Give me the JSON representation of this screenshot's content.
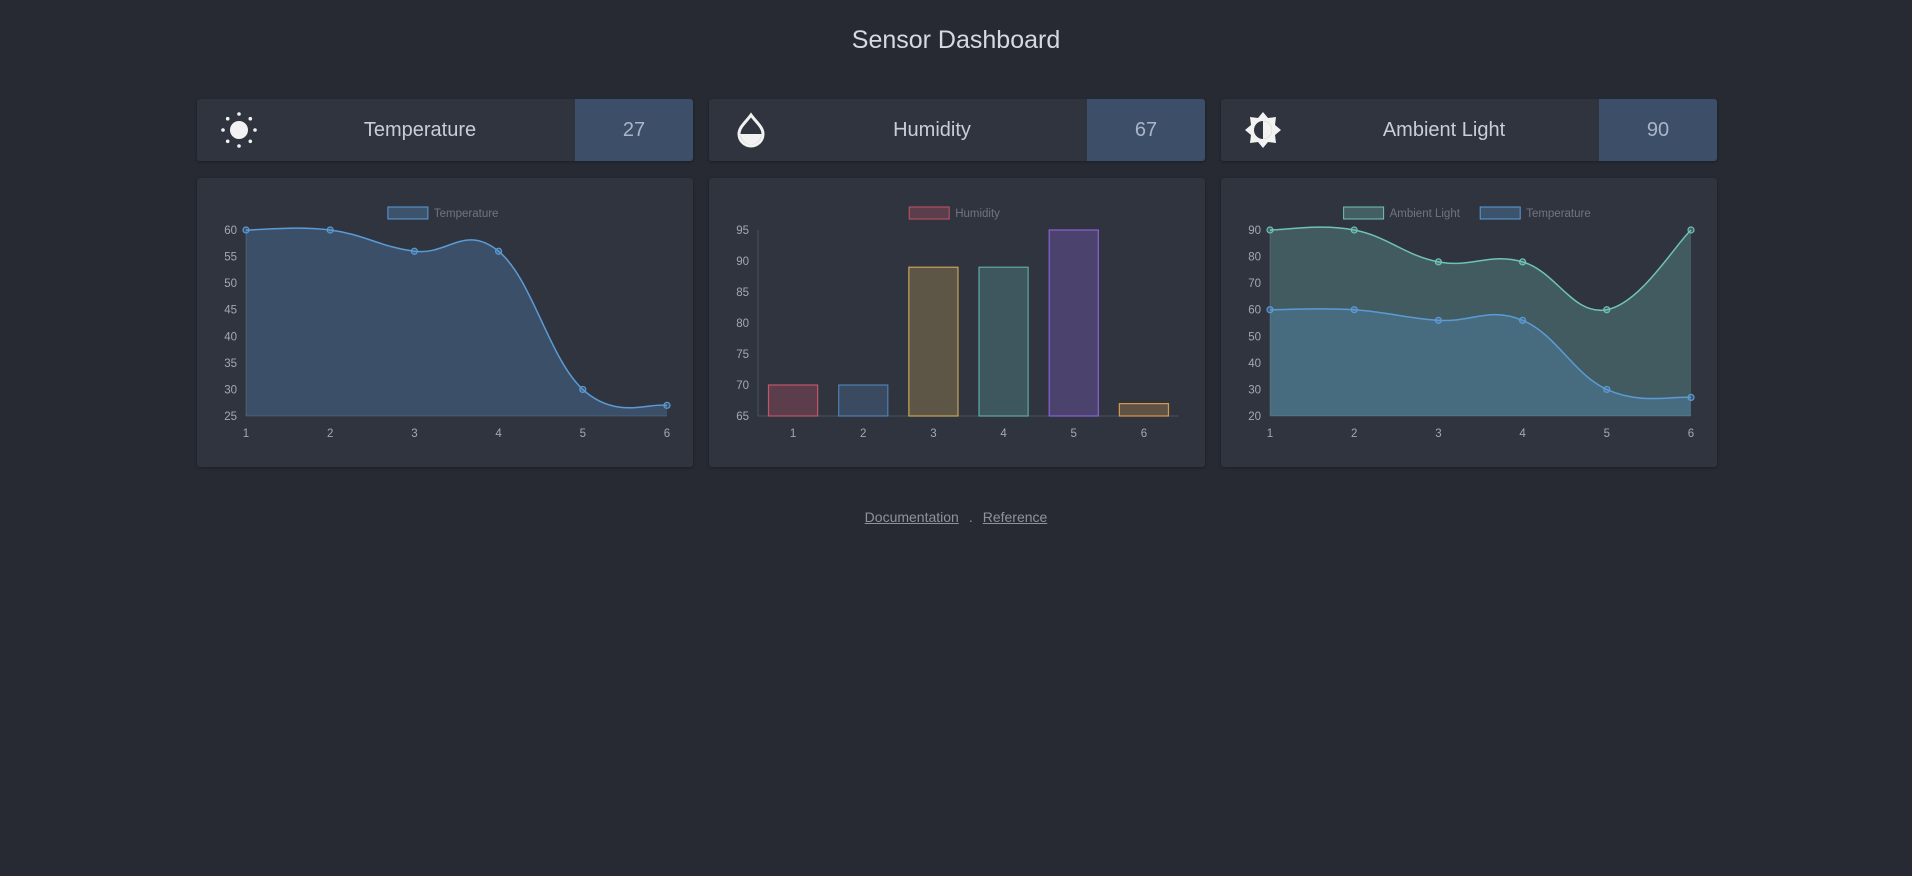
{
  "page": {
    "title": "Sensor Dashboard"
  },
  "cards": [
    {
      "label": "Temperature",
      "value": "27",
      "icon": "sun-icon"
    },
    {
      "label": "Humidity",
      "value": "67",
      "icon": "droplet-icon"
    },
    {
      "label": "Ambient Light",
      "value": "90",
      "icon": "brightness-icon"
    }
  ],
  "footer": {
    "links": [
      "Documentation",
      "Reference"
    ],
    "separator": "."
  },
  "colors": {
    "background": "#272a33",
    "panel": "#30343f",
    "value_box": "#3d4e68",
    "temperature": "#5b9bd5",
    "ambient_light": "#6fc3b6"
  },
  "chart_data": [
    {
      "type": "area",
      "x": [
        "1",
        "2",
        "3",
        "4",
        "5",
        "6"
      ],
      "ylim": [
        25,
        60
      ],
      "yticks": [
        25,
        30,
        35,
        40,
        45,
        50,
        55,
        60
      ],
      "series": [
        {
          "name": "Temperature",
          "values": [
            60,
            60,
            56,
            56,
            30,
            27
          ],
          "color": "#5b9bd5"
        }
      ],
      "legend": "top-center",
      "grid": false
    },
    {
      "type": "bar",
      "categories": [
        "1",
        "2",
        "3",
        "4",
        "5",
        "6"
      ],
      "ylim": [
        65,
        95
      ],
      "yticks": [
        65,
        70,
        75,
        80,
        85,
        90,
        95
      ],
      "series": [
        {
          "name": "Humidity",
          "values": [
            70,
            70,
            89,
            89,
            95,
            67
          ]
        }
      ],
      "bar_colors": [
        "#c4546a",
        "#4f7fb0",
        "#c8a558",
        "#5fa8a6",
        "#8a62d6",
        "#d39a4f"
      ],
      "legend": "top-center",
      "grid": false
    },
    {
      "type": "area",
      "x": [
        "1",
        "2",
        "3",
        "4",
        "5",
        "6"
      ],
      "ylim": [
        20,
        90
      ],
      "yticks": [
        20,
        30,
        40,
        50,
        60,
        70,
        80,
        90
      ],
      "series": [
        {
          "name": "Ambient Light",
          "values": [
            90,
            90,
            78,
            78,
            60,
            90
          ],
          "color": "#6fc3b6"
        },
        {
          "name": "Temperature",
          "values": [
            60,
            60,
            56,
            56,
            30,
            27
          ],
          "color": "#5b9bd5"
        }
      ],
      "legend": "top-center",
      "grid": false
    }
  ]
}
